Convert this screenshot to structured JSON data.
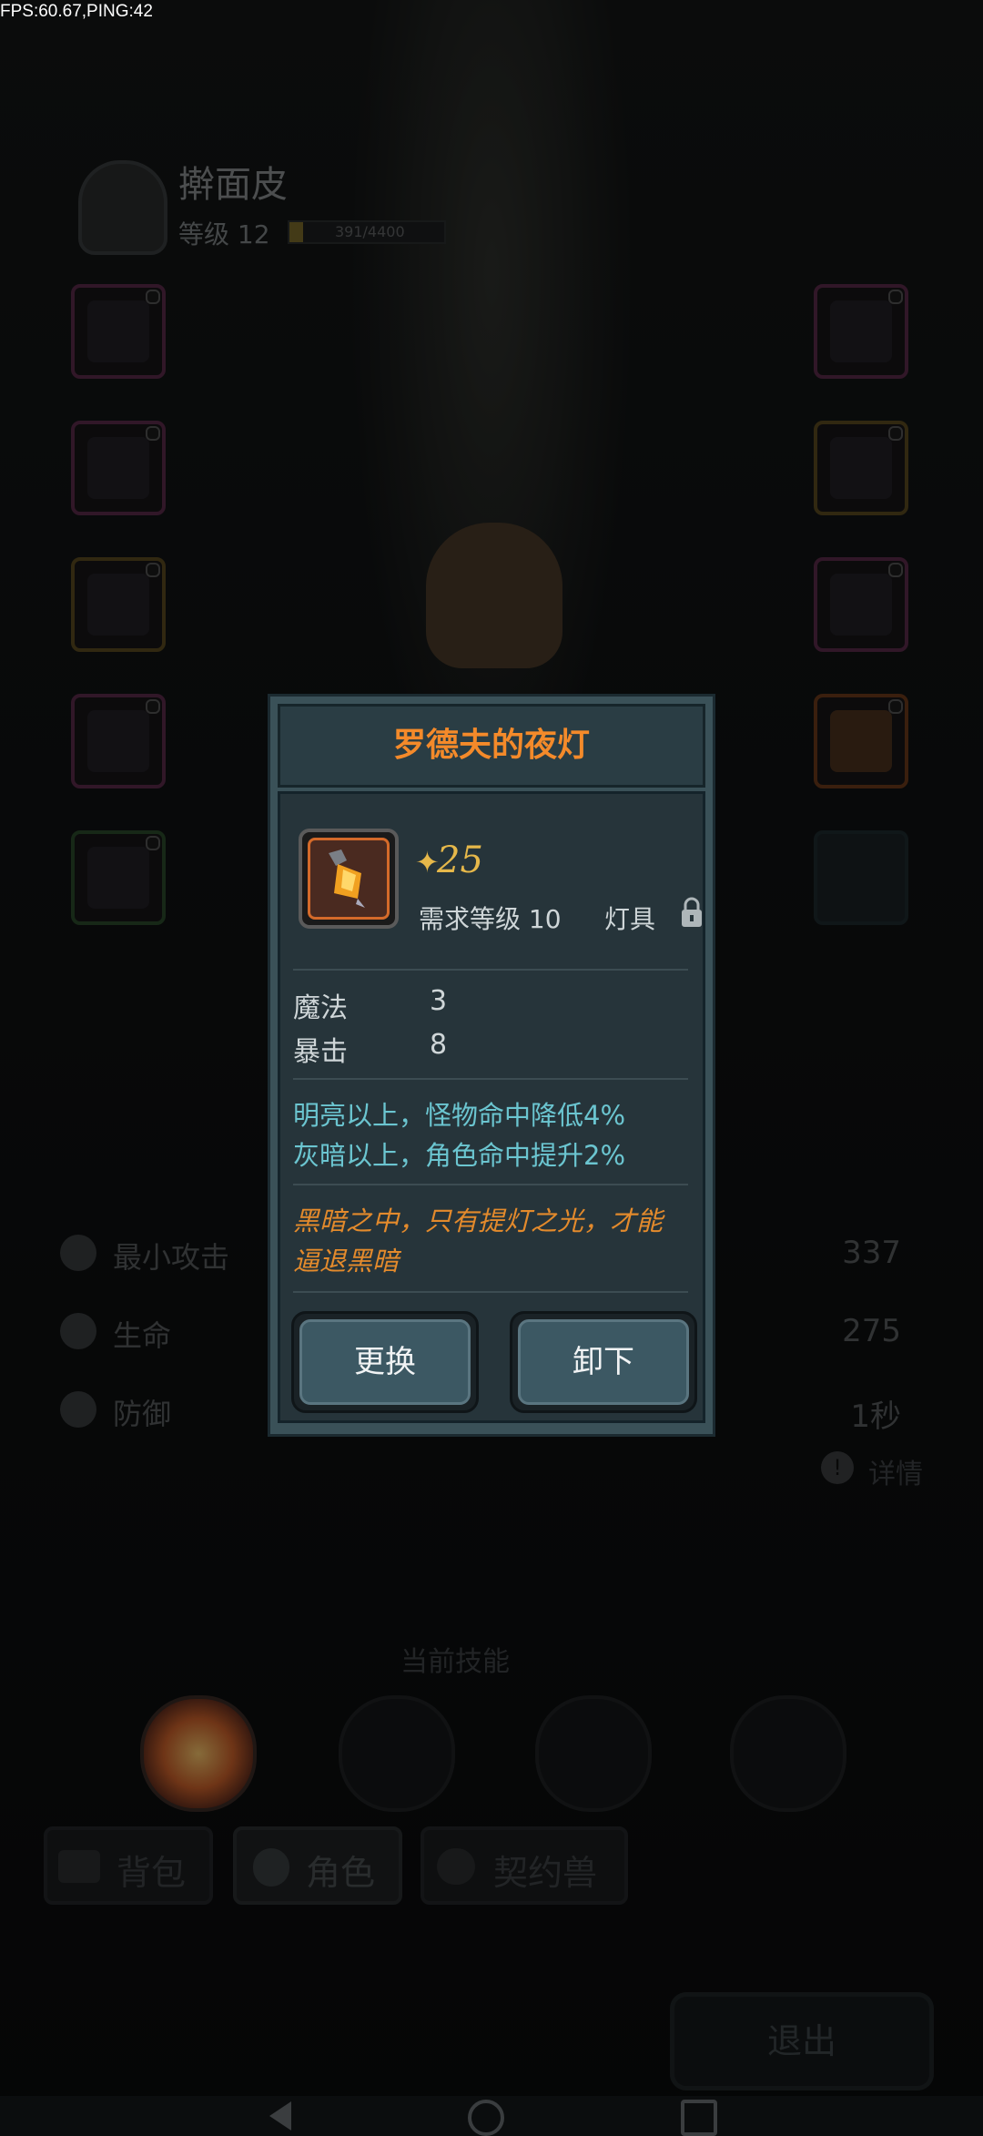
{
  "debug": {
    "fps_ping": "FPS:60.67,PING:42"
  },
  "player": {
    "name": "擀面皮",
    "level_label": "等级 12",
    "xp_text": "391/4400",
    "xp_fraction": 0.09
  },
  "stats": [
    {
      "icon": "sword-icon",
      "label": "最小攻击",
      "value": "337"
    },
    {
      "icon": "heart-icon",
      "label": "生命",
      "value": "275"
    },
    {
      "icon": "shield-icon",
      "label": "防御",
      "value": "1秒"
    }
  ],
  "detail_link": "详情",
  "skills": {
    "title": "当前技能"
  },
  "tabs": [
    {
      "icon": "backpack-icon",
      "label": "背包"
    },
    {
      "icon": "character-icon",
      "label": "角色"
    },
    {
      "icon": "paw-icon",
      "label": "契约兽"
    }
  ],
  "exit_label": "退出",
  "item_dialog": {
    "title": "罗德夫的夜灯",
    "power": "25",
    "required_level": "需求等级 10",
    "item_type": "灯具",
    "attributes": [
      {
        "name": "魔法",
        "value": "3"
      },
      {
        "name": "暴击",
        "value": "8"
      }
    ],
    "effects": [
      "明亮以上，怪物命中降低4%",
      "灰暗以上，角色命中提升2%"
    ],
    "lore": [
      "黑暗之中，只有提灯之光，才能",
      "逼退黑暗"
    ],
    "buttons": {
      "replace": "更换",
      "unequip": "卸下"
    }
  },
  "colors": {
    "title": "#f48a2a",
    "effect": "#6bc5d0",
    "lore": "#e38a2c",
    "power": "#e6b84a"
  }
}
